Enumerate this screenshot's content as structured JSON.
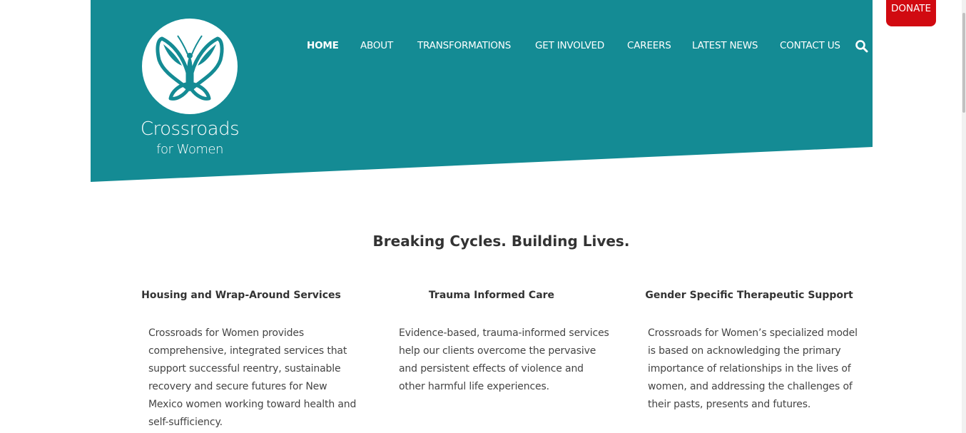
{
  "brand": {
    "name_line1": "Crossroads",
    "name_line2": "for Women",
    "color": "#148b94"
  },
  "nav": {
    "items": [
      {
        "label": "HOME",
        "active": true
      },
      {
        "label": "ABOUT",
        "active": false
      },
      {
        "label": "TRANSFORMATIONS",
        "active": false
      },
      {
        "label": "GET INVOLVED",
        "active": false
      },
      {
        "label": "CAREERS",
        "active": false
      },
      {
        "label": "LATEST NEWS",
        "active": false
      },
      {
        "label": "CONTACT US",
        "active": false
      }
    ],
    "search_icon": "search-icon"
  },
  "donate": {
    "label": "DONATE",
    "color": "#d10a11"
  },
  "main": {
    "tagline": "Breaking Cycles. Building Lives.",
    "columns": [
      {
        "title": "Housing and Wrap-Around Services",
        "body": "Crossroads for Women provides comprehensive, integrated services that support successful reentry, sustainable recovery and secure futures for New Mexico women working toward health and self-sufficiency."
      },
      {
        "title": "Trauma Informed Care",
        "body": "Evidence-based, trauma-informed services help our clients overcome the pervasive and persistent effects of violence and other harmful life experiences."
      },
      {
        "title": "Gender Specific Therapeutic Support",
        "body": "Crossroads for Women’s specialized model is based on acknowledging the primary importance of relationships in the lives of women, and addressing the challenges of their pasts, presents and futures."
      }
    ]
  }
}
